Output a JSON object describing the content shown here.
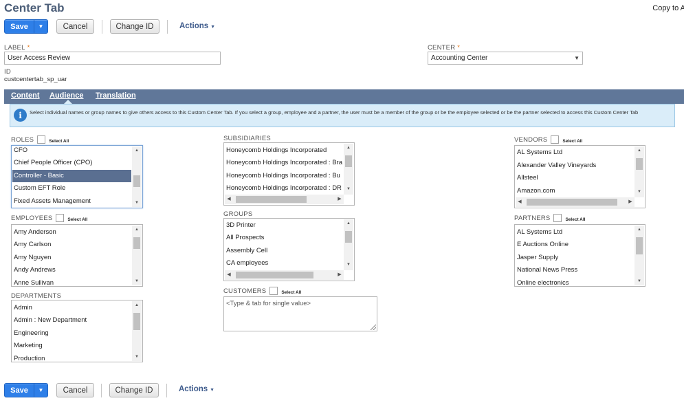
{
  "page": {
    "title": "Center Tab",
    "copy_to": "Copy to A"
  },
  "toolbar": {
    "save_label": "Save",
    "cancel_label": "Cancel",
    "change_id_label": "Change ID",
    "actions_label": "Actions"
  },
  "form": {
    "label_label": "LABEL",
    "label_value": "User Access Review",
    "center_label": "CENTER",
    "center_value": "Accounting Center",
    "id_label": "ID",
    "id_value": "custcentertab_sp_uar"
  },
  "tabs": [
    {
      "label": "Content"
    },
    {
      "label": "Audience"
    },
    {
      "label": "Translation"
    }
  ],
  "info_text": "Select individual names or group names to give others access to this Custom Center Tab. If you select a group, employee and a partner, the user must be a member of the group or be the employee selected or be the partner selected to access this Custom Center Tab",
  "select_all": "Select All",
  "roles": {
    "label": "ROLES",
    "items": [
      "CFO",
      "Chief People Officer (CPO)",
      "Controller - Basic",
      "Custom EFT Role",
      "Fixed Assets Management"
    ],
    "selected": "Controller - Basic"
  },
  "employees": {
    "label": "EMPLOYEES",
    "items": [
      "Amy Anderson",
      "Amy Carlson",
      "Amy Nguyen",
      "Andy Andrews",
      "Anne Sullivan"
    ]
  },
  "departments": {
    "label": "DEPARTMENTS",
    "items": [
      "Admin",
      "Admin : New Department",
      "Engineering",
      "Marketing",
      "Production"
    ]
  },
  "subsidiaries": {
    "label": "SUBSIDIARIES",
    "items": [
      "Honeycomb Holdings Incorporated",
      "Honeycomb Holdings Incorporated : Bra",
      "Honeycomb Holdings Incorporated : Bu",
      "Honeycomb Holdings Incorporated : DR"
    ]
  },
  "groups": {
    "label": "GROUPS",
    "items": [
      "3D Printer",
      "All Prospects",
      "Assembly Cell",
      "CA employees"
    ]
  },
  "customers": {
    "label": "CUSTOMERS",
    "placeholder": "<Type & tab for single value>"
  },
  "vendors": {
    "label": "VENDORS",
    "items": [
      "AL Systems Ltd",
      "Alexander Valley Vineyards",
      "Allsteel",
      "Amazon.com"
    ]
  },
  "partners": {
    "label": "PARTNERS",
    "items": [
      "AL Systems Ltd",
      "E Auctions Online",
      "Jasper Supply",
      "National News Press",
      "Online electronics"
    ]
  },
  "icons": {
    "info": "info-icon",
    "dropdown": "chevron-down-icon",
    "up": "scroll-up-icon",
    "down": "scroll-down-icon",
    "left": "scroll-left-icon",
    "right": "scroll-right-icon"
  },
  "colors": {
    "save_button": "#2e7fe8",
    "tab_bar": "#607799",
    "info_banner": "#daedf9",
    "selected_item": "#5a6f91",
    "required": "#e3791c"
  }
}
